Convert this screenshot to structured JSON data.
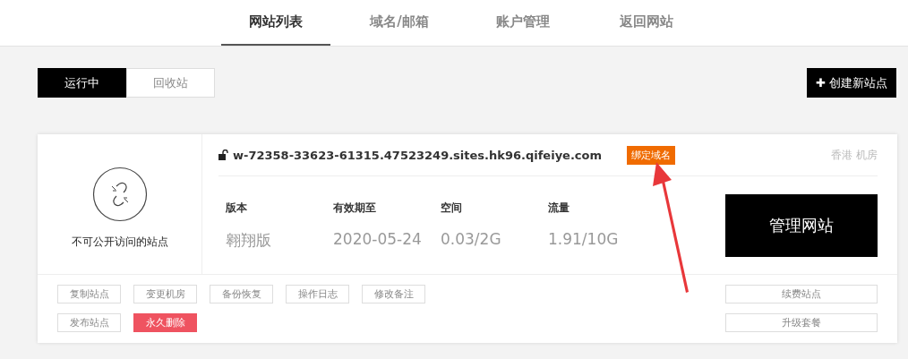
{
  "nav_tabs": [
    {
      "label": "网站列表",
      "selected": true
    },
    {
      "label": "域名/邮箱",
      "selected": false
    },
    {
      "label": "账户管理",
      "selected": false
    },
    {
      "label": "返回网站",
      "selected": false
    }
  ],
  "filter_tabs": [
    {
      "label": "运行中",
      "selected": true
    },
    {
      "label": "回收站",
      "selected": false
    }
  ],
  "create_button": {
    "icon": "✚",
    "label": "创建新站点"
  },
  "site": {
    "status": "不可公开访问的站点",
    "domain": "w-72358-33623-61315.47523249.sites.hk96.qifeiye.com",
    "bind_badge": "绑定域名",
    "location": "香港 机房",
    "stats": [
      {
        "label": "版本",
        "value": "翱翔版"
      },
      {
        "label": "有效期至",
        "value": "2020-05-24"
      },
      {
        "label": "空间",
        "value": "0.03/2G"
      },
      {
        "label": "流量",
        "value": "1.91/10G"
      }
    ],
    "manage_button": "管理网站",
    "actions": [
      [
        {
          "label": "复制站点",
          "kind": "normal"
        },
        {
          "label": "变更机房",
          "kind": "normal"
        },
        {
          "label": "备份恢复",
          "kind": "normal"
        },
        {
          "label": "操作日志",
          "kind": "normal"
        },
        {
          "label": "修改备注",
          "kind": "normal"
        }
      ],
      [
        {
          "label": "发布站点",
          "kind": "normal"
        },
        {
          "label": "永久删除",
          "kind": "danger"
        }
      ]
    ],
    "side_actions": [
      "续费站点",
      "升级套餐"
    ]
  }
}
